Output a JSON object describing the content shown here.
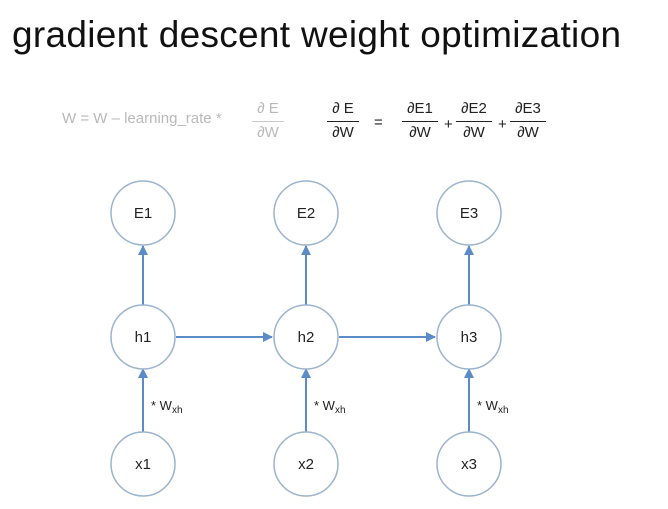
{
  "title": "gradient descent weight optimization",
  "update_rule": {
    "lhs": "W = W – learning_rate *",
    "numerator": "∂ E",
    "denominator": "∂W"
  },
  "gradient_sum": {
    "lhs_numerator": "∂ E",
    "lhs_denominator": "∂W",
    "equals": "=",
    "plus": "+",
    "terms": [
      {
        "numerator": "∂E1",
        "denominator": "∂W"
      },
      {
        "numerator": "∂E2",
        "denominator": "∂W"
      },
      {
        "numerator": "∂E3",
        "denominator": "∂W"
      }
    ]
  },
  "nodes": {
    "errors": [
      "E1",
      "E2",
      "E3"
    ],
    "hidden": [
      "h1",
      "h2",
      "h3"
    ],
    "inputs": [
      "x1",
      "x2",
      "x3"
    ]
  },
  "edge_labels": {
    "prefix": "* W",
    "subscript": "xh"
  },
  "colors": {
    "node_stroke": "#9ab3cf",
    "arrow": "#5b8cc7",
    "formula_gray": "#b9b9b9",
    "text": "#222222"
  }
}
